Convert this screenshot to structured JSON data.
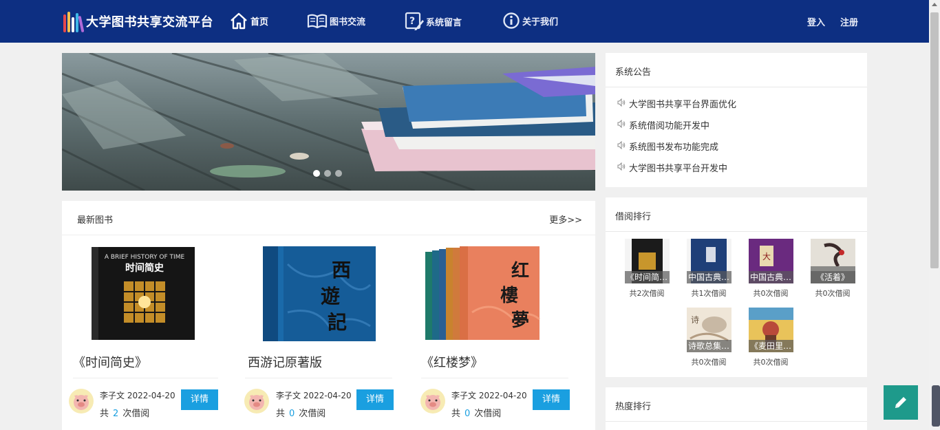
{
  "nav": {
    "logo_text": "大学图书共享交流平台",
    "items": [
      {
        "label": "首页",
        "icon": "home-icon"
      },
      {
        "label": "图书交流",
        "icon": "open-book-icon"
      },
      {
        "label": "系统留言",
        "icon": "message-edit-icon"
      },
      {
        "label": "关于我们",
        "icon": "info-icon"
      }
    ],
    "login_label": "登入",
    "register_label": "注册"
  },
  "banner": {
    "slide_count": 3,
    "active_slide": 1
  },
  "notice": {
    "title": "系统公告",
    "items": [
      "大学图书共享平台界面优化",
      "系统借阅功能开发中",
      "系统图书发布功能完成",
      "大学图书共享平台开发中"
    ]
  },
  "borrow_rank": {
    "title": "借阅排行",
    "items": [
      {
        "caption": "《时间简…",
        "count": "共2次借阅"
      },
      {
        "caption": "中国古典…",
        "count": "共1次借阅"
      },
      {
        "caption": "中国古典…",
        "count": "共0次借阅"
      },
      {
        "caption": "《活着》",
        "count": "共0次借阅"
      },
      {
        "caption": "诗歌总集…",
        "count": "共0次借阅"
      },
      {
        "caption": "《麦田里…",
        "count": "共0次借阅"
      }
    ]
  },
  "hot_rank": {
    "title": "热度排行"
  },
  "latest": {
    "title": "最新图书",
    "more_label": "更多>>",
    "books": [
      {
        "title": "《时间简史》",
        "author": "李子文",
        "date": "2022-04-20",
        "borrow_prefix": "共",
        "borrow_count": "2",
        "borrow_suffix": "次借阅",
        "detail_label": "详情"
      },
      {
        "title": "西游记原著版",
        "author": "李子文",
        "date": "2022-04-20",
        "borrow_prefix": "共",
        "borrow_count": "0",
        "borrow_suffix": "次借阅",
        "detail_label": "详情"
      },
      {
        "title": "《红楼梦》",
        "author": "李子文",
        "date": "2022-04-20",
        "borrow_prefix": "共",
        "borrow_count": "0",
        "borrow_suffix": "次借阅",
        "detail_label": "详情"
      }
    ]
  },
  "cover_art": {
    "brief_history_en": "A BRIEF HISTORY OF TIME",
    "brief_history_cn": "时间简史",
    "xiyouji": "西遊記",
    "hongloumeng": "红樓夢"
  },
  "colors": {
    "nav_bg": "#0d2f82",
    "accent": "#1a9fe0",
    "fab": "#1e9a8b"
  }
}
